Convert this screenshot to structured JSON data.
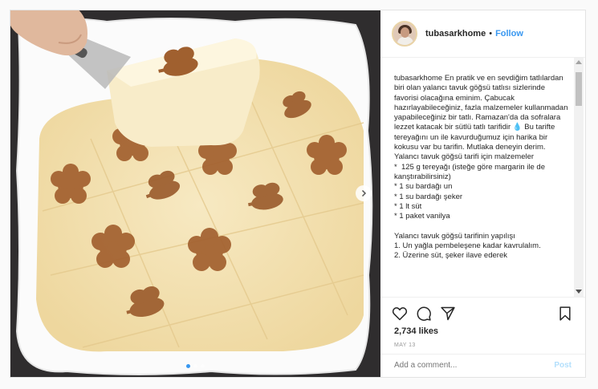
{
  "header": {
    "username": "tubasarkhome",
    "separator": "•",
    "follow_label": "Follow"
  },
  "caption": {
    "text": "tubasarkhome En pratik ve en sevdiğim tatlılardan biri olan yalancı tavuk göğsü tatlısı sizlerinde favorisi olacağına eminim. Çabucak hazırlayabileceğiniz, fazla malzemeler kullanmadan yapabileceğiniz bir tatlı. Ramazan'da da sofralara lezzet katacak bir sütlü tatlı tarifidir 💧 Bu tarifte tereyağını un ile kavurduğumuz için harika bir kokusu var bu tarifin. Mutlaka deneyin derim.\nYalancı tavuk göğsü tarifi için malzemeler\n*  125 g tereyağı (isteğe göre margarin ile de kanştırabilirsiniz)\n* 1 su bardağı un\n* 1 su bardağı şeker\n* 1 lt süt\n* 1 paket vanilya\n\nYalancı tavuk göğsü tarifinin yapılışı\n1. Un yağla pembeleşene kadar kavrulalım.\n2. Üzerine süt, şeker ilave ederek"
  },
  "engagement": {
    "likes": "2,734 likes",
    "date": "MAY 13"
  },
  "comment": {
    "placeholder": "Add a comment...",
    "post_label": "Post"
  },
  "icons": {
    "like": "heart-icon",
    "comment": "comment-icon",
    "share": "share-icon",
    "save": "bookmark-icon",
    "next": "chevron-right-icon"
  },
  "carousel": {
    "slides": 3,
    "active": 1
  },
  "colors": {
    "link": "#3897f0",
    "text": "#262626",
    "muted": "#999999",
    "post_disabled": "#b2dffc"
  }
}
